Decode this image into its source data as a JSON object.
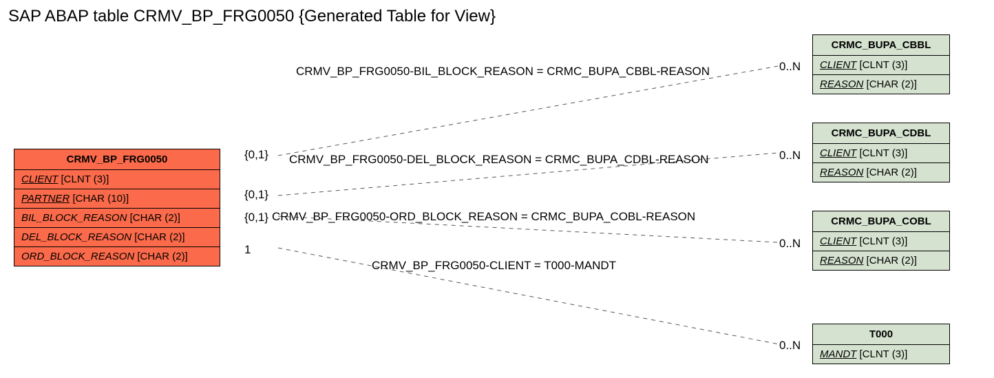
{
  "title": "SAP ABAP table CRMV_BP_FRG0050 {Generated Table for View}",
  "primary": {
    "name": "CRMV_BP_FRG0050",
    "fields": [
      {
        "name": "CLIENT",
        "type": "[CLNT (3)]",
        "key": true
      },
      {
        "name": "PARTNER",
        "type": "[CHAR (10)]",
        "key": true
      },
      {
        "name": "BIL_BLOCK_REASON",
        "type": "[CHAR (2)]",
        "key": false
      },
      {
        "name": "DEL_BLOCK_REASON",
        "type": "[CHAR (2)]",
        "key": false
      },
      {
        "name": "ORD_BLOCK_REASON",
        "type": "[CHAR (2)]",
        "key": false
      }
    ]
  },
  "refs": [
    {
      "name": "CRMC_BUPA_CBBL",
      "fields": [
        {
          "name": "CLIENT",
          "type": "[CLNT (3)]",
          "key": true
        },
        {
          "name": "REASON",
          "type": "[CHAR (2)]",
          "key": true
        }
      ]
    },
    {
      "name": "CRMC_BUPA_CDBL",
      "fields": [
        {
          "name": "CLIENT",
          "type": "[CLNT (3)]",
          "key": true
        },
        {
          "name": "REASON",
          "type": "[CHAR (2)]",
          "key": true
        }
      ]
    },
    {
      "name": "CRMC_BUPA_COBL",
      "fields": [
        {
          "name": "CLIENT",
          "type": "[CLNT (3)]",
          "key": true
        },
        {
          "name": "REASON",
          "type": "[CHAR (2)]",
          "key": true
        }
      ]
    },
    {
      "name": "T000",
      "fields": [
        {
          "name": "MANDT",
          "type": "[CLNT (3)]",
          "key": true
        }
      ]
    }
  ],
  "relations": [
    {
      "label": "CRMV_BP_FRG0050-BIL_BLOCK_REASON = CRMC_BUPA_CBBL-REASON",
      "left_card": "{0,1}",
      "right_card": "0..N"
    },
    {
      "label": "CRMV_BP_FRG0050-DEL_BLOCK_REASON = CRMC_BUPA_CDBL-REASON",
      "left_card": "{0,1}",
      "right_card": "0..N"
    },
    {
      "label": "CRMV_BP_FRG0050-ORD_BLOCK_REASON = CRMC_BUPA_COBL-REASON",
      "left_card": "{0,1}",
      "right_card": "0..N"
    },
    {
      "label": "CRMV_BP_FRG0050-CLIENT = T000-MANDT",
      "left_card": "1",
      "right_card": "0..N"
    }
  ]
}
